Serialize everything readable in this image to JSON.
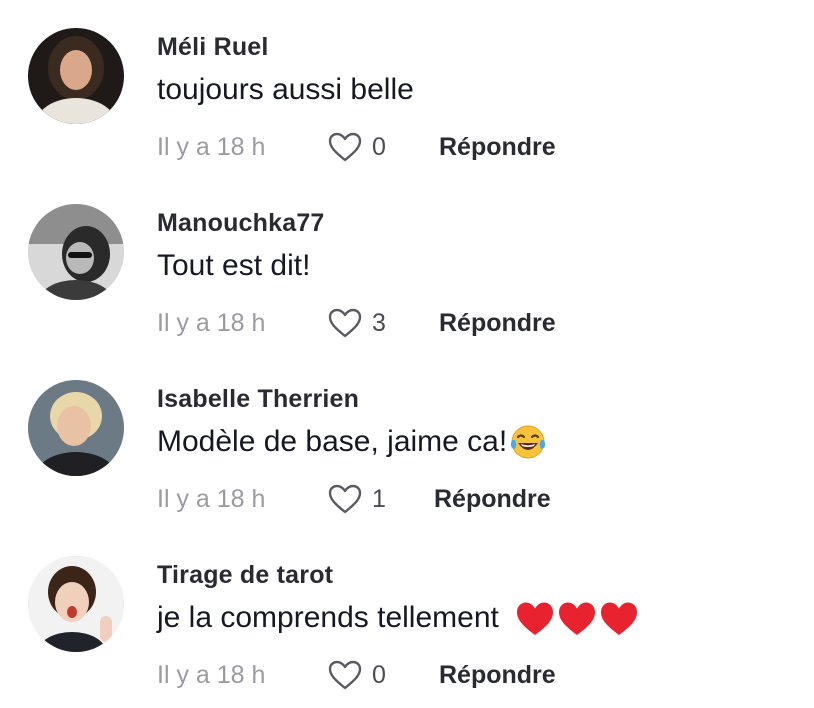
{
  "comments": [
    {
      "username": "Méli Ruel",
      "text": "toujours aussi belle",
      "time": "Il y a 18 h",
      "likes": "0",
      "reply_label": "Répondre",
      "emoji": []
    },
    {
      "username": "Manouchka77",
      "text": "Tout est dit!",
      "time": "Il y a 18 h",
      "likes": "3",
      "reply_label": "Répondre",
      "emoji": []
    },
    {
      "username": "Isabelle Therrien",
      "text": "Modèle de base, jaime ca!",
      "time": "Il y a 18 h",
      "likes": "1",
      "reply_label": "Répondre",
      "emoji": [
        "face-with-tears-of-joy"
      ]
    },
    {
      "username": "Tirage de tarot",
      "text": "je la comprends tellement",
      "time": "Il y a 18 h",
      "likes": "0",
      "reply_label": "Répondre",
      "emoji": [
        "red-heart",
        "red-heart",
        "red-heart"
      ]
    }
  ],
  "colors": {
    "text": "#161823",
    "meta": "#9a9ba1",
    "heart": "#e8232f",
    "background": "#ffffff"
  }
}
